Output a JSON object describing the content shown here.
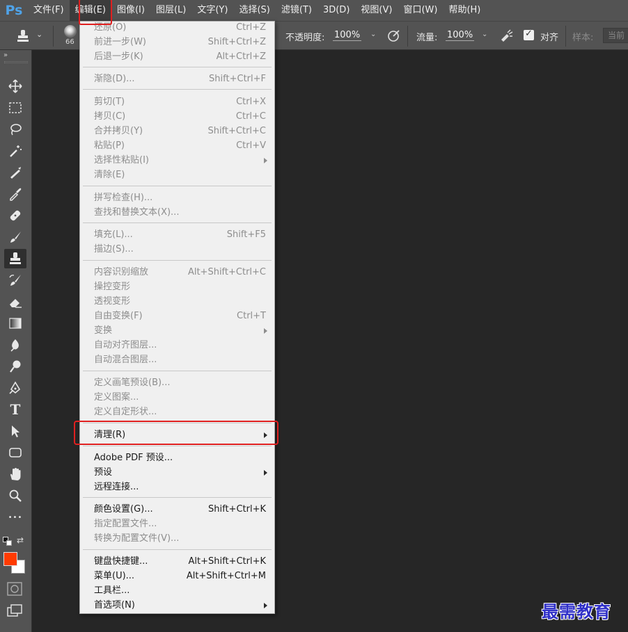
{
  "app": {
    "logo": "Ps"
  },
  "menubar": {
    "items": [
      "文件(F)",
      "编辑(E)",
      "图像(I)",
      "图层(L)",
      "文字(Y)",
      "选择(S)",
      "滤镜(T)",
      "3D(D)",
      "视图(V)",
      "窗口(W)",
      "帮助(H)"
    ],
    "active_index": 1
  },
  "options": {
    "brush_size": "66",
    "opacity_label": "不透明度:",
    "opacity_value": "100%",
    "flow_label": "流量:",
    "flow_value": "100%",
    "align_label": "对齐",
    "align_checked": true,
    "sample_label": "样本:",
    "sample_value": "当前"
  },
  "toolbar": {
    "collapse": "»",
    "tools": [
      "move-icon",
      "marquee-icon",
      "lasso-icon",
      "magic-wand-icon",
      "crop-icon",
      "eyedropper-icon",
      "healing-brush-icon",
      "brush-icon",
      "clone-stamp-icon",
      "history-brush-icon",
      "eraser-icon",
      "gradient-icon",
      "blur-icon",
      "dodge-icon",
      "pen-icon",
      "type-icon",
      "path-select-icon",
      "rectangle-icon",
      "hand-icon",
      "zoom-icon",
      "more-icon"
    ],
    "selected_tool": "clone-stamp-icon",
    "type_tool_glyph": "T",
    "more_glyph": "•••",
    "foreground_color": "#ff3b00",
    "background_color": "#ffffff"
  },
  "edit_menu": {
    "items": [
      {
        "label": "还原(O)",
        "shortcut": "Ctrl+Z",
        "disabled": true
      },
      {
        "label": "前进一步(W)",
        "shortcut": "Shift+Ctrl+Z",
        "disabled": true
      },
      {
        "label": "后退一步(K)",
        "shortcut": "Alt+Ctrl+Z",
        "disabled": true
      },
      {
        "label": "渐隐(D)...",
        "shortcut": "Shift+Ctrl+F",
        "disabled": true
      },
      {
        "label": "剪切(T)",
        "shortcut": "Ctrl+X",
        "disabled": true
      },
      {
        "label": "拷贝(C)",
        "shortcut": "Ctrl+C",
        "disabled": true
      },
      {
        "label": "合并拷贝(Y)",
        "shortcut": "Shift+Ctrl+C",
        "disabled": true
      },
      {
        "label": "粘贴(P)",
        "shortcut": "Ctrl+V",
        "disabled": true
      },
      {
        "label": "选择性粘贴(I)",
        "shortcut": "",
        "disabled": true,
        "submenu": true
      },
      {
        "label": "清除(E)",
        "shortcut": "",
        "disabled": true
      },
      {
        "label": "拼写检查(H)...",
        "shortcut": "",
        "disabled": true
      },
      {
        "label": "查找和替换文本(X)...",
        "shortcut": "",
        "disabled": true
      },
      {
        "label": "填充(L)...",
        "shortcut": "Shift+F5",
        "disabled": true
      },
      {
        "label": "描边(S)...",
        "shortcut": "",
        "disabled": true
      },
      {
        "label": "内容识别缩放",
        "shortcut": "Alt+Shift+Ctrl+C",
        "disabled": true
      },
      {
        "label": "操控变形",
        "shortcut": "",
        "disabled": true
      },
      {
        "label": "透视变形",
        "shortcut": "",
        "disabled": true
      },
      {
        "label": "自由变换(F)",
        "shortcut": "Ctrl+T",
        "disabled": true
      },
      {
        "label": "变换",
        "shortcut": "",
        "disabled": true,
        "submenu": true
      },
      {
        "label": "自动对齐图层...",
        "shortcut": "",
        "disabled": true
      },
      {
        "label": "自动混合图层...",
        "shortcut": "",
        "disabled": true
      },
      {
        "label": "定义画笔预设(B)...",
        "shortcut": "",
        "disabled": true
      },
      {
        "label": "定义图案...",
        "shortcut": "",
        "disabled": true
      },
      {
        "label": "定义自定形状...",
        "shortcut": "",
        "disabled": true
      },
      {
        "label": "清理(R)",
        "shortcut": "",
        "disabled": false,
        "submenu": true,
        "highlighted": true
      },
      {
        "label": "Adobe PDF 预设...",
        "shortcut": "",
        "disabled": false
      },
      {
        "label": "预设",
        "shortcut": "",
        "disabled": false,
        "submenu": true
      },
      {
        "label": "远程连接...",
        "shortcut": "",
        "disabled": false
      },
      {
        "label": "颜色设置(G)...",
        "shortcut": "Shift+Ctrl+K",
        "disabled": false
      },
      {
        "label": "指定配置文件...",
        "shortcut": "",
        "disabled": true
      },
      {
        "label": "转换为配置文件(V)...",
        "shortcut": "",
        "disabled": true
      },
      {
        "label": "键盘快捷键...",
        "shortcut": "Alt+Shift+Ctrl+K",
        "disabled": false
      },
      {
        "label": "菜单(U)...",
        "shortcut": "Alt+Shift+Ctrl+M",
        "disabled": false
      },
      {
        "label": "工具栏...",
        "shortcut": "",
        "disabled": false
      },
      {
        "label": "首选项(N)",
        "shortcut": "",
        "disabled": false,
        "submenu": true
      }
    ]
  },
  "watermark": "最需教育"
}
